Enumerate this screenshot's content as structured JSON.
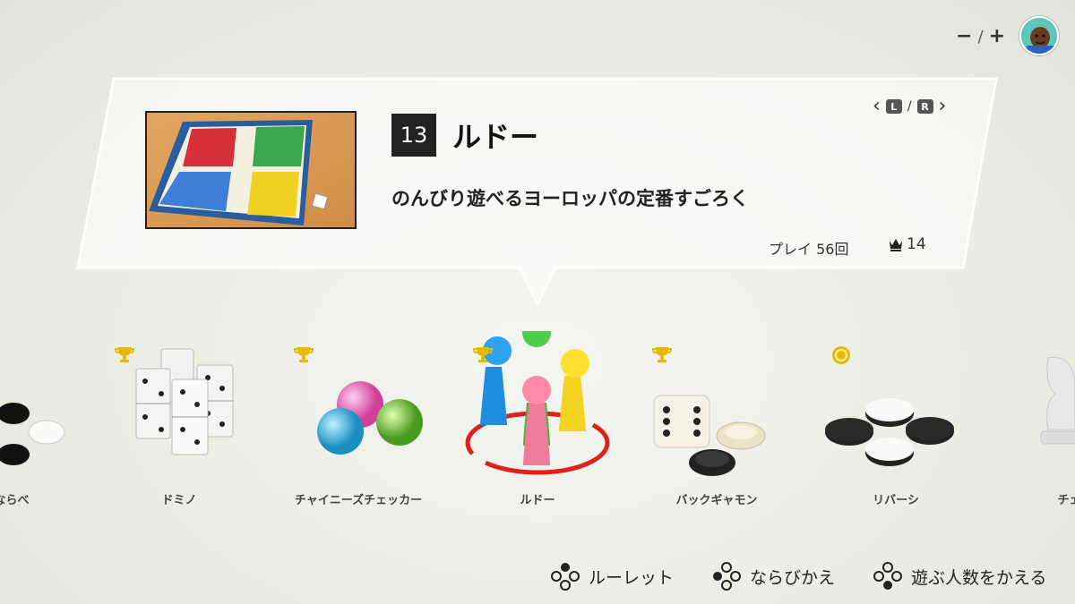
{
  "header": {
    "zoom_minus": "−",
    "zoom_sep": "/",
    "zoom_plus": "+",
    "avatar_icon": "user-avatar-icon"
  },
  "selected": {
    "number": "13",
    "title": "ルドー",
    "description": "のんびり遊べるヨーロッパの定番すごろく",
    "plays": "プレイ 56回",
    "crowns": "14",
    "nav_left": "L",
    "nav_sep": "/",
    "nav_right": "R"
  },
  "games": [
    {
      "label": "五目ならべ",
      "award": "none"
    },
    {
      "label": "ドミノ",
      "award": "trophy"
    },
    {
      "label": "チャイニーズチェッカー",
      "award": "trophy"
    },
    {
      "label": "ルドー",
      "award": "trophy"
    },
    {
      "label": "バックギャモン",
      "award": "trophy"
    },
    {
      "label": "リバーシ",
      "award": "coin"
    },
    {
      "label": "チェス",
      "award": "none"
    }
  ],
  "footer": {
    "roulette": "ルーレット",
    "sort": "ならびかえ",
    "players": "遊ぶ人数をかえる"
  },
  "colors": {
    "accent_ring": "#e0201c",
    "gold": "#e6b800",
    "panel_border": "#ffffff"
  }
}
